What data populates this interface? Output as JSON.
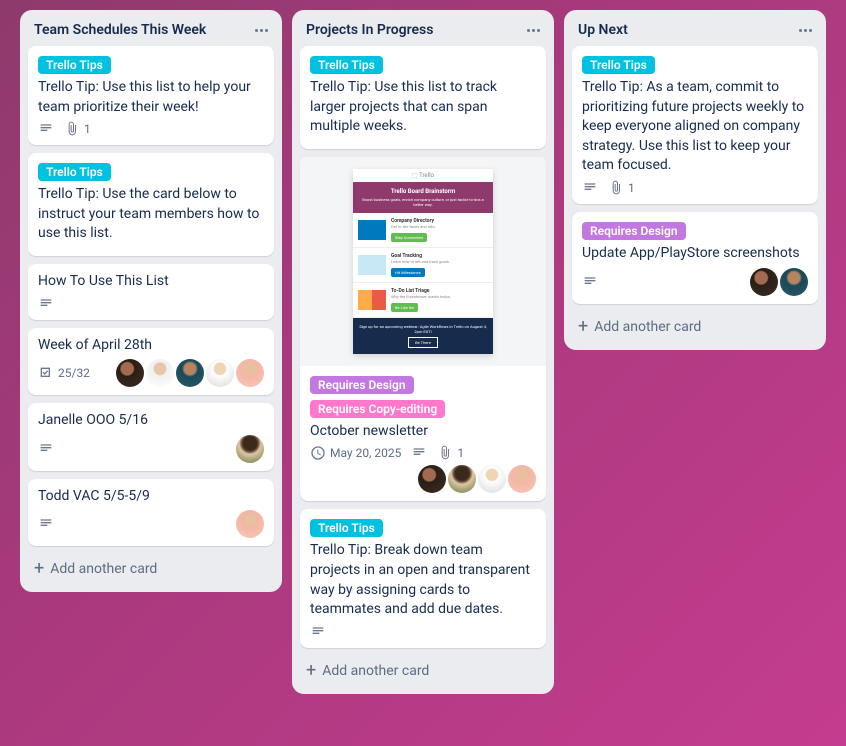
{
  "lists": [
    {
      "title": "Team Schedules This Week",
      "add_card": "Add another card"
    },
    {
      "title": "Projects In Progress",
      "add_card": "Add another card"
    },
    {
      "title": "Up Next",
      "add_card": "Add another card"
    }
  ],
  "labels": {
    "trello_tips": "Trello Tips",
    "requires_design": "Requires Design",
    "requires_copy": "Requires Copy-editing"
  },
  "col0": {
    "card0": {
      "title": "Trello Tip: Use this list to help your team prioritize their week!",
      "attach_count": "1"
    },
    "card1": {
      "title": "Trello Tip: Use the card below to instruct your team members how to use this list."
    },
    "card2": {
      "title": "How To Use This List"
    },
    "card3": {
      "title": "Week of April 28th",
      "checklist": "25/32"
    },
    "card4": {
      "title": "Janelle OOO 5/16"
    },
    "card5": {
      "title": "Todd VAC 5/5-5/9"
    }
  },
  "col1": {
    "card0": {
      "title": "Trello Tip: Use this list to track larger projects that can span multiple weeks."
    },
    "card1": {
      "title": "October newsletter",
      "due": "May 20, 2025",
      "attach_count": "1"
    },
    "card2": {
      "title": "Trello Tip: Break down team projects in an open and transparent way by assigning cards to teammates and add due dates."
    }
  },
  "col2": {
    "card0": {
      "title": "Trello Tip: As a team, commit to prioritizing future projects weekly to keep everyone aligned on company strategy. Use this list to keep your team focused.",
      "attach_count": "1"
    },
    "card1": {
      "title": "Update App/PlayStore screenshots"
    }
  }
}
